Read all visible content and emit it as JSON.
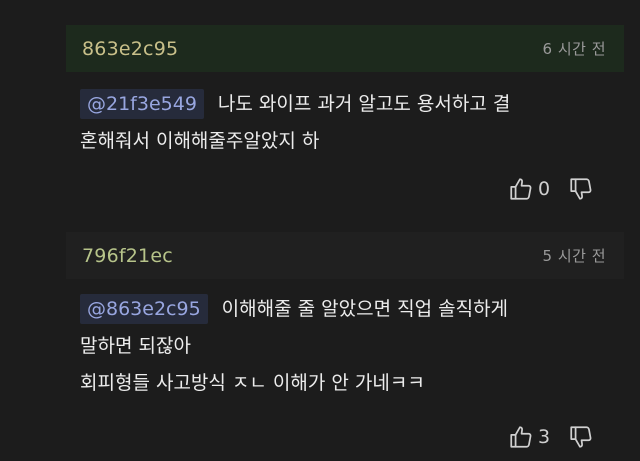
{
  "comments": [
    {
      "username": "863e2c95",
      "time": "6 시간 전",
      "mention": "@21f3e549",
      "text_lines": [
        "나도 와이프 과거 알고도 용서하고 결",
        "혼해줘서 이해해줄주알았지 하"
      ],
      "likes": "0",
      "highlighted": true
    },
    {
      "username": "796f21ec",
      "time": "5 시간 전",
      "mention": "@863e2c95",
      "text_lines": [
        "이해해줄 줄 알았으면 직업 솔직하게",
        "말하면 되잖아",
        "회피형들 사고방식 ㅈㄴ 이해가 안 가네ㅋㅋ"
      ],
      "likes": "3",
      "highlighted": false
    }
  ],
  "icons": {
    "like": "thumbs-up-icon",
    "dislike": "thumbs-down-icon"
  },
  "colors": {
    "background": "#1c1c1c",
    "highlight_header": "#1d2a1d",
    "mention_bg": "#262b3b",
    "mention_text": "#98a6e0"
  }
}
